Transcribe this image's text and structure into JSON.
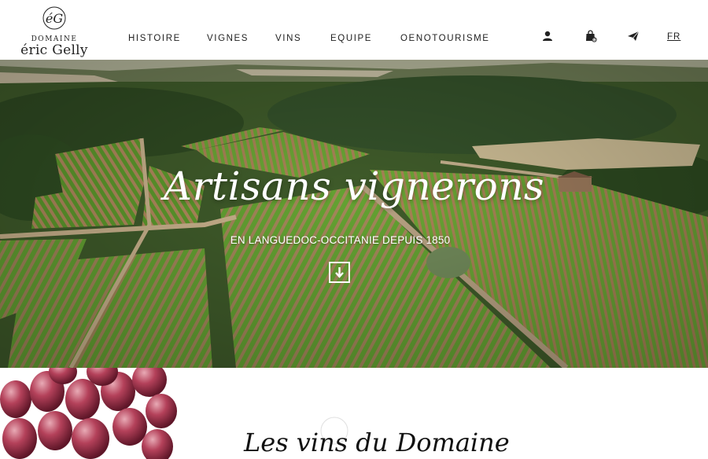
{
  "brand": {
    "monogram": "éG",
    "line1": "DOMAINE",
    "line2": "éric Gelly"
  },
  "nav": {
    "items": [
      {
        "label": "HISTOIRE"
      },
      {
        "label": "VIGNES"
      },
      {
        "label": "VINS"
      },
      {
        "label": "EQUIPE"
      },
      {
        "label": "OENOTOURISME"
      }
    ],
    "icons": [
      "user-icon",
      "shopping-bag-icon",
      "paper-plane-icon"
    ],
    "language": "FR"
  },
  "hero": {
    "title": "Artisans vignerons",
    "subtitle": "EN LANGUEDOC-OCCITANIE DEPUIS 1850",
    "scroll_icon": "arrow-down-icon"
  },
  "section": {
    "title": "Les vins du Domaine"
  }
}
